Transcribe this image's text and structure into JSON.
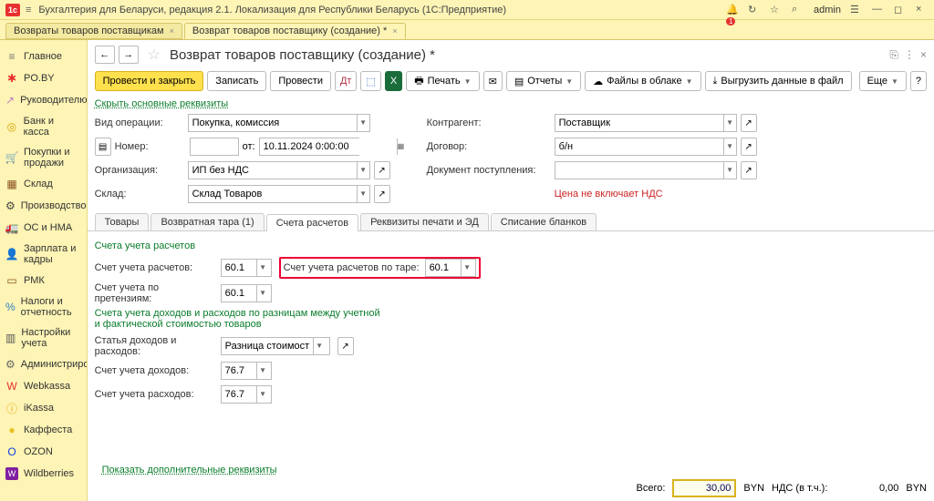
{
  "topbar": {
    "logo_text": "1c",
    "title": "Бухгалтерия для Беларуси, редакция 2.1. Локализация для Республики Беларусь   (1С:Предприятие)",
    "user": "admin",
    "notif_count": "1"
  },
  "window_tabs": [
    {
      "label": "Возвраты товаров поставщикам"
    },
    {
      "label": "Возврат товаров поставщику (создание) *"
    }
  ],
  "sidebar": {
    "items": [
      {
        "label": "Главное",
        "icon": "≡",
        "color": "#777"
      },
      {
        "label": "PO.BY",
        "icon": "✱",
        "color": "#e8312f"
      },
      {
        "label": "Руководителю",
        "icon": "↗",
        "color": "#c080c0"
      },
      {
        "label": "Банк и касса",
        "icon": "◎",
        "color": "#d8a000"
      },
      {
        "label": "Покупки и продажи",
        "icon": "🛒",
        "color": "#333"
      },
      {
        "label": "Склад",
        "icon": "▦",
        "color": "#8a5020"
      },
      {
        "label": "Производство",
        "icon": "⚙",
        "color": "#444"
      },
      {
        "label": "ОС и НМА",
        "icon": "🚛",
        "color": "#333"
      },
      {
        "label": "Зарплата и кадры",
        "icon": "👤",
        "color": "#3060c0"
      },
      {
        "label": "РМК",
        "icon": "▭",
        "color": "#8a5020"
      },
      {
        "label": "Налоги и отчетность",
        "icon": "%",
        "color": "#3080c0"
      },
      {
        "label": "Настройки учета",
        "icon": "▥",
        "color": "#555"
      },
      {
        "label": "Администрирование",
        "icon": "⚙",
        "color": "#666"
      },
      {
        "label": "Webkassa",
        "icon": "W",
        "color": "#e8312f"
      },
      {
        "label": "iKassa",
        "icon": "ⓘ",
        "color": "#e8a000"
      },
      {
        "label": "Каффеста",
        "icon": "●",
        "color": "#e8c020"
      },
      {
        "label": "OZON",
        "icon": "O",
        "color": "#1040e0"
      },
      {
        "label": "Wildberries",
        "icon": "W",
        "color": "#8020a0"
      }
    ]
  },
  "doc": {
    "title": "Возврат товаров поставщику (создание) *",
    "toolbar": {
      "post_close": "Провести и закрыть",
      "save": "Записать",
      "post": "Провести",
      "print": "Печать",
      "reports": "Отчеты",
      "files_cloud": "Файлы в облаке",
      "export_file": "Выгрузить данные в файл",
      "more": "Еще"
    },
    "main_req_link": "Скрыть основные реквизиты",
    "left_fields": {
      "op_type_lbl": "Вид операции:",
      "op_type_val": "Покупка, комиссия",
      "number_lbl": "Номер:",
      "number_val": "",
      "date_lbl": "от:",
      "date_val": "10.11.2024 0:00:00",
      "org_lbl": "Организация:",
      "org_val": "ИП без НДС",
      "wh_lbl": "Склад:",
      "wh_val": "Склад Товаров"
    },
    "right_fields": {
      "counter_lbl": "Контрагент:",
      "counter_val": "Поставщик",
      "contract_lbl": "Договор:",
      "contract_val": "б/н",
      "supply_lbl": "Документ поступления:",
      "supply_val": "",
      "price_note": "Цена не включает НДС"
    },
    "tabs": [
      {
        "label": "Товары"
      },
      {
        "label": "Возвратная тара (1)"
      },
      {
        "label": "Счета расчетов"
      },
      {
        "label": "Реквизиты печати и ЭД"
      },
      {
        "label": "Списание бланков"
      }
    ],
    "accounts": {
      "section1": "Счета учета расчетов",
      "settle_lbl": "Счет учета расчетов:",
      "settle_val": "60.1",
      "tare_lbl": "Счет учета расчетов по таре:",
      "tare_val": "60.1",
      "claims_lbl": "Счет учета  по претензиям:",
      "claims_val": "60.1",
      "section2": "Счета учета доходов и расходов по разницам между учетной и фактической стоимостью товаров",
      "article_lbl": "Статья доходов и расходов:",
      "article_val": "Разница стоимости во",
      "income_lbl": "Счет учета доходов:",
      "income_val": "76.7",
      "expense_lbl": "Счет учета расходов:",
      "expense_val": "76.7"
    },
    "footer_link": "Показать дополнительные реквизиты",
    "totals": {
      "total_lbl": "Всего:",
      "total_val": "30,00",
      "cur1": "BYN",
      "vat_lbl": "НДС (в т.ч.):",
      "vat_val": "0,00",
      "cur2": "BYN"
    }
  }
}
